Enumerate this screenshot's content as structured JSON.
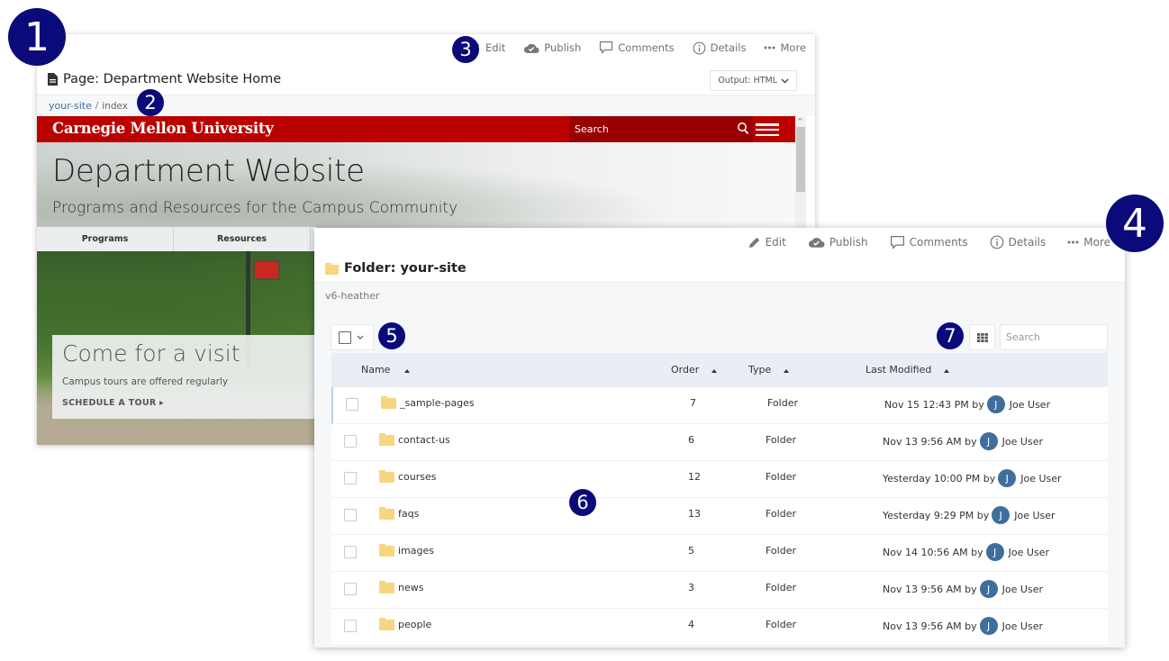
{
  "callouts": [
    "1",
    "2",
    "3",
    "4",
    "5",
    "6",
    "7"
  ],
  "page_view": {
    "toolbar": [
      {
        "label": "Edit",
        "icon": "pencil-icon"
      },
      {
        "label": "Publish",
        "icon": "cloud-check-icon"
      },
      {
        "label": "Comments",
        "icon": "comment-icon"
      },
      {
        "label": "Details",
        "icon": "info-icon"
      },
      {
        "label": "More",
        "icon": "more-icon"
      }
    ],
    "title": "Page: Department Website Home",
    "output_select": "Output: HTML",
    "breadcrumb": {
      "parent": "your-site",
      "separator": "/",
      "current": "index"
    },
    "preview": {
      "logo": "Carnegie Mellon University",
      "search_placeholder": "Search",
      "hero_title": "Department Website",
      "hero_subtitle": "Programs and Resources for the Campus Community",
      "nav": [
        "Programs",
        "Resources"
      ],
      "visit_title": "Come for a visit",
      "visit_subtitle": "Campus tours are offered regularly",
      "visit_cta": "SCHEDULE A TOUR ▸",
      "brand_color": "#bb0000"
    }
  },
  "folder_view": {
    "toolbar": [
      {
        "label": "Edit",
        "icon": "pencil-icon"
      },
      {
        "label": "Publish",
        "icon": "cloud-check-icon"
      },
      {
        "label": "Comments",
        "icon": "comment-icon"
      },
      {
        "label": "Details",
        "icon": "info-icon"
      },
      {
        "label": "More",
        "icon": "more-icon"
      }
    ],
    "title": "Folder: your-site",
    "breadcrumb": "v6-heather",
    "search_placeholder": "Search",
    "columns": [
      "Name",
      "Order",
      "Type",
      "Last Modified"
    ],
    "rows": [
      {
        "name": "_sample-pages",
        "order": "7",
        "type": "Folder",
        "modified": "Nov 15 12:43 PM by",
        "user": "Joe User",
        "avatar": "J"
      },
      {
        "name": "contact-us",
        "order": "6",
        "type": "Folder",
        "modified": "Nov 13 9:56 AM by",
        "user": "Joe User",
        "avatar": "J"
      },
      {
        "name": "courses",
        "order": "12",
        "type": "Folder",
        "modified": "Yesterday 10:00 PM by",
        "user": "Joe User",
        "avatar": "J"
      },
      {
        "name": "faqs",
        "order": "13",
        "type": "Folder",
        "modified": "Yesterday 9:29 PM by",
        "user": "Joe User",
        "avatar": "J"
      },
      {
        "name": "images",
        "order": "5",
        "type": "Folder",
        "modified": "Nov 14 10:56 AM by",
        "user": "Joe User",
        "avatar": "J"
      },
      {
        "name": "news",
        "order": "3",
        "type": "Folder",
        "modified": "Nov 13 9:56 AM by",
        "user": "Joe User",
        "avatar": "J"
      },
      {
        "name": "people",
        "order": "4",
        "type": "Folder",
        "modified": "Nov 13 9:56 AM by",
        "user": "Joe User",
        "avatar": "J"
      }
    ]
  }
}
